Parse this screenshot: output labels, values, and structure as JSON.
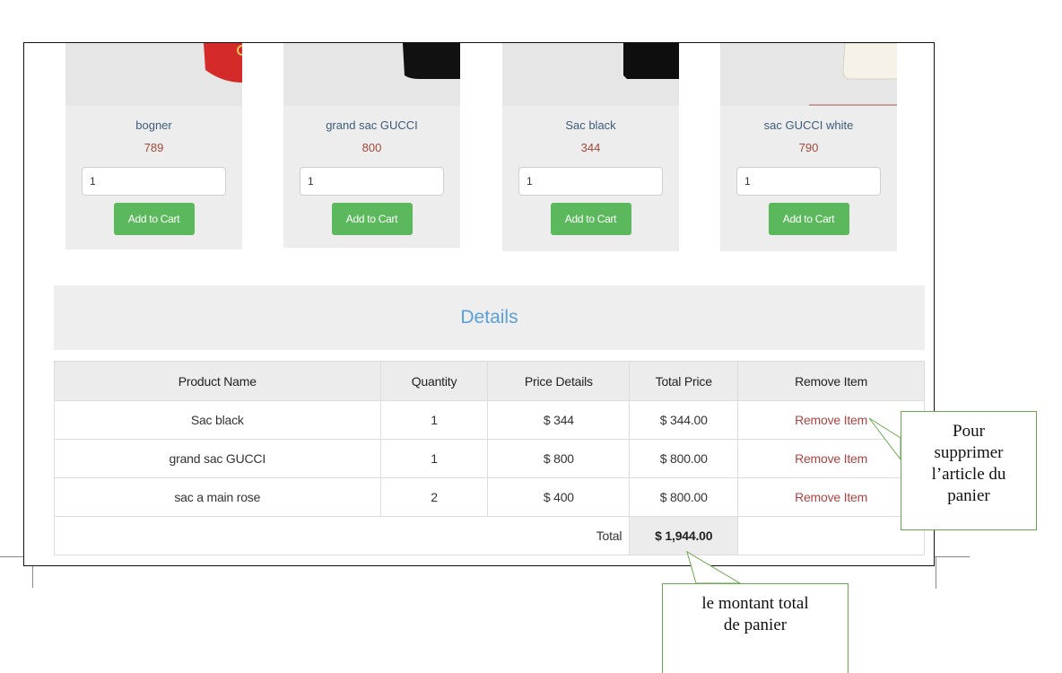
{
  "products": [
    {
      "name": "bogner",
      "price": "789",
      "qty": "1",
      "button": "Add to Cart",
      "bag": "red-belt-bag"
    },
    {
      "name": "grand sac GUCCI",
      "price": "800",
      "qty": "1",
      "button": "Add to Cart",
      "bag": "black-bag"
    },
    {
      "name": "Sac black",
      "price": "344",
      "qty": "1",
      "button": "Add to Cart",
      "bag": "black-bag"
    },
    {
      "name": "sac GUCCI white",
      "price": "790",
      "qty": "1",
      "button": "Add to Cart",
      "bag": "white-bag"
    }
  ],
  "details_title": "Details",
  "table": {
    "headers": [
      "Product Name",
      "Quantity",
      "Price Details",
      "Total Price",
      "Remove Item"
    ],
    "rows": [
      {
        "name": "Sac black",
        "qty": "1",
        "price": "$ 344",
        "total": "$ 344.00",
        "remove": "Remove Item"
      },
      {
        "name": "grand sac GUCCI",
        "qty": "1",
        "price": "$ 800",
        "total": "$ 800.00",
        "remove": "Remove Item"
      },
      {
        "name": "sac a main rose",
        "qty": "2",
        "price": "$ 400",
        "total": "$ 800.00",
        "remove": "Remove Item"
      }
    ],
    "total_label": "Total",
    "total_amount": "$ 1,944.00"
  },
  "callouts": {
    "remove": {
      "line1": "Pour",
      "line2": "supprimer",
      "line3": "l’article du",
      "line4": "panier"
    },
    "total": {
      "line1": "le montant total",
      "line2": "de panier"
    }
  },
  "colors": {
    "add_button": "#5cb85c",
    "details_title": "#5aa0d8",
    "remove_link": "#a94442",
    "callout_border": "#6aa84f"
  }
}
